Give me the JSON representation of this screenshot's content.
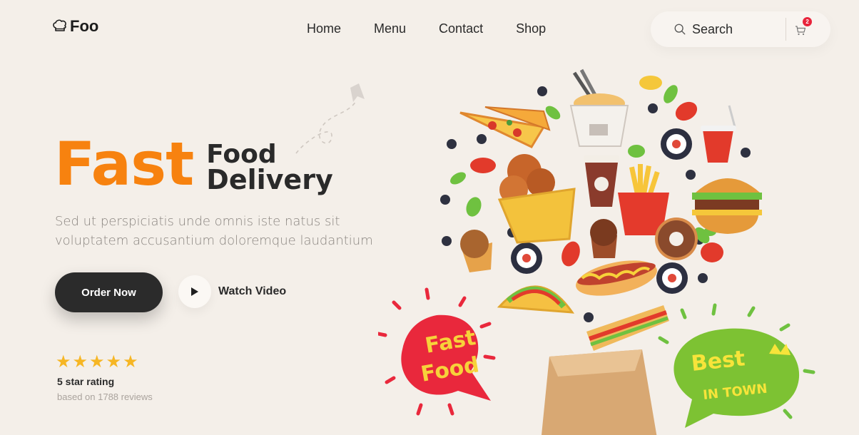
{
  "brand": {
    "name": "Foo"
  },
  "nav": {
    "items": [
      "Home",
      "Menu",
      "Contact",
      "Shop"
    ]
  },
  "search": {
    "label": "Search"
  },
  "cart": {
    "count": "2"
  },
  "hero": {
    "title_main": "Fast",
    "title_line1": "Food",
    "title_line2": "Delivery",
    "description": "Sed ut perspiciatis unde omnis iste natus sit voluptatem accusantium doloremque laudantium"
  },
  "actions": {
    "order": "Order Now",
    "watch": "Watch Video"
  },
  "rating": {
    "stars": "★★★★★",
    "title": "5 star rating",
    "subtitle": "based on 1788 reviews"
  },
  "stickers": {
    "left_line1": "Fast",
    "left_line2": "Food",
    "right_line1": "Best",
    "right_line2": "IN TOWN"
  },
  "colors": {
    "accent": "#f7820f",
    "dark": "#2b2b2b",
    "background": "#f4efe9",
    "star": "#f6b624",
    "badge": "#e8243b"
  }
}
